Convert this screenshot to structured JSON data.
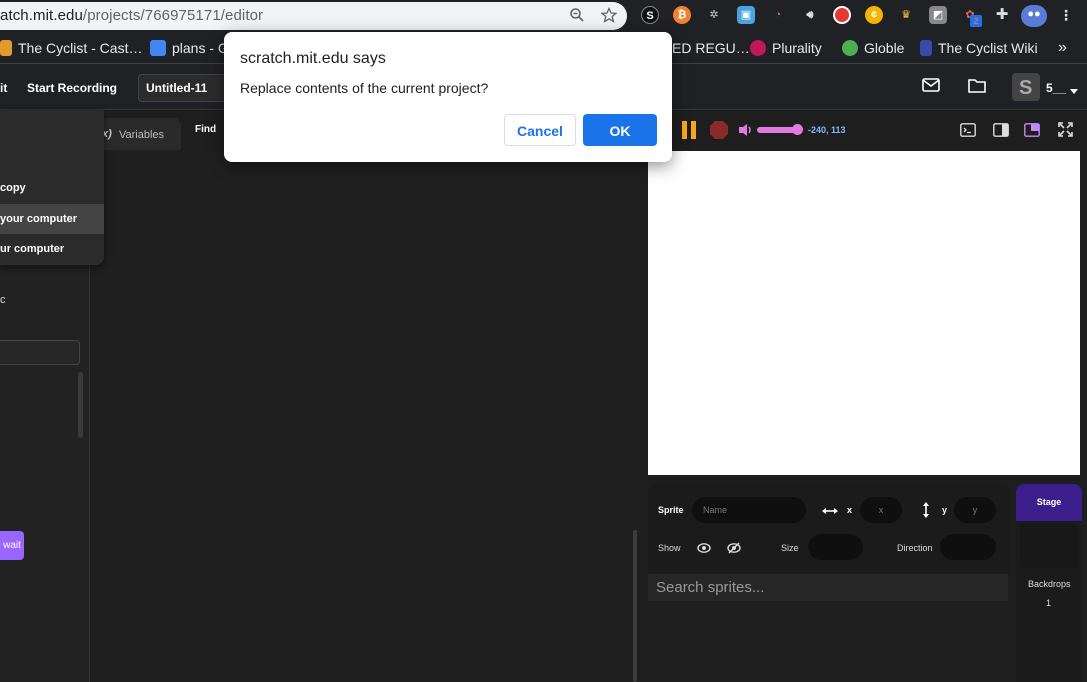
{
  "browser": {
    "url_host": "atch.mit.edu",
    "url_path": "/projects/766975171/editor",
    "extension_badge": "2"
  },
  "bookmarks": [
    {
      "label": "The Cyclist - Cast…"
    },
    {
      "label": "plans - G"
    },
    {
      "label": "ED REGU…"
    },
    {
      "label": "Plurality"
    },
    {
      "label": "Globle"
    },
    {
      "label": "The Cyclist Wiki"
    }
  ],
  "bookmarks_more": "»",
  "menubar": {
    "partial_item": "it",
    "start_recording": "Start Recording",
    "project_title": "Untitled-11",
    "account_name": "5__"
  },
  "file_menu": {
    "items": [
      {
        "label": "copy"
      },
      {
        "label": "your computer"
      },
      {
        "label": "ur computer"
      }
    ]
  },
  "tabs": {
    "variables_prefix": "x)",
    "variables": "Variables",
    "find": "Find"
  },
  "palette": {
    "side_c": "c",
    "wait_block": "wait"
  },
  "stage_controls": {
    "coords": "-240, 113",
    "volume_percent": 85
  },
  "sprite_info": {
    "sprite_label": "Sprite",
    "name_placeholder": "Name",
    "x_label": "x",
    "x_placeholder": "x",
    "y_label": "y",
    "y_placeholder": "y",
    "show_label": "Show",
    "size_label": "Size",
    "direction_label": "Direction",
    "search_placeholder": "Search sprites..."
  },
  "stage_panel": {
    "title": "Stage",
    "backdrops_label": "Backdrops",
    "backdrops_count": "1"
  },
  "dialog": {
    "title": "scratch.mit.edu says",
    "message": "Replace contents of the current project?",
    "cancel": "Cancel",
    "ok": "OK"
  },
  "colors": {
    "accent": "#1a73e8",
    "scratch_purple": "#9966ff",
    "stage_header": "#3b1e8c"
  }
}
